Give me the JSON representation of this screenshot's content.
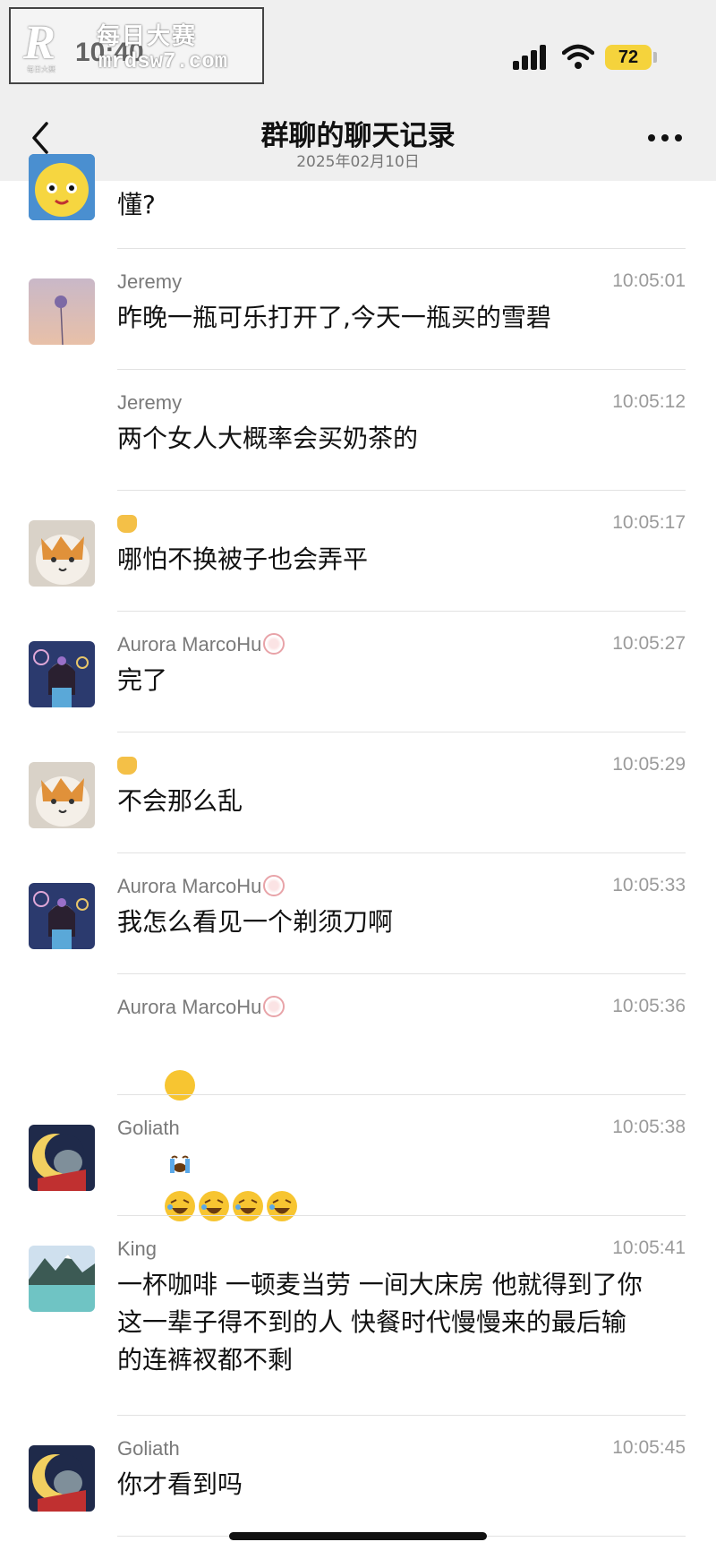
{
  "status_bar": {
    "time": "10:40",
    "battery": "72"
  },
  "watermark": {
    "logo": "R",
    "logo_sub": "每日大赛",
    "cn": "每日大赛",
    "url": "mrdsw7.com"
  },
  "header": {
    "title": "群聊的聊天记录",
    "date": "2025年02月10日"
  },
  "messages": [
    {
      "sender": "",
      "time": "",
      "text": "懂?"
    },
    {
      "sender": "Jeremy",
      "time": "10:05:01",
      "text": "昨晚一瓶可乐打开了,今天一瓶买的雪碧"
    },
    {
      "sender": "Jeremy",
      "time": "10:05:12",
      "text": "两个女人大概率会买奶茶的"
    },
    {
      "sender": "",
      "time": "10:05:17",
      "text": "哪怕不换被子也会弄平"
    },
    {
      "sender": "Aurora MarcoHu",
      "time": "10:05:27",
      "text": "完了"
    },
    {
      "sender": "",
      "time": "10:05:29",
      "text": "不会那么乱"
    },
    {
      "sender": "Aurora MarcoHu",
      "time": "10:05:33",
      "text": "我怎么看见一个剃须刀啊"
    },
    {
      "sender": "Aurora MarcoHu",
      "time": "10:05:36",
      "text": ""
    },
    {
      "sender": "Goliath",
      "time": "10:05:38",
      "text": ""
    },
    {
      "sender": "King",
      "time": "10:05:41",
      "text": "一杯咖啡 一顿麦当劳 一间大床房 他就得到了你\n这一辈子得不到的人 快餐时代慢慢来的最后输\n的连裤衩都不剩"
    },
    {
      "sender": "Goliath",
      "time": "10:05:45",
      "text": "你才看到吗"
    }
  ],
  "icons": {
    "back": "chevron-left-icon",
    "more": "more-dots-icon",
    "crying": "loudly-crying-face-emoji",
    "laughing": "rolling-laughing-emoji",
    "cat": "cat-face-emoji",
    "flower_badge": "flower-badge-icon"
  },
  "colors": {
    "header_bg": "#efefef",
    "battery": "#f5d33c",
    "meta_text": "#7a7a7a"
  }
}
